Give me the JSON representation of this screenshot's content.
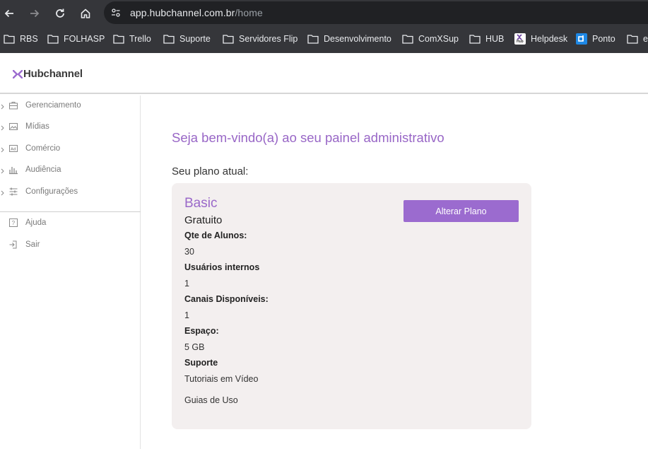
{
  "browser": {
    "url_host": "app.hubchannel.com.br",
    "url_path": "/home",
    "bookmarks": [
      "RBS",
      "FOLHASP",
      "Trello",
      "Suporte",
      "Servidores Flip",
      "Desenvolvimento",
      "ComXSup",
      "HUB",
      "Helpdesk",
      "Ponto",
      "e"
    ],
    "helpdesk_favicon_text": "Hub"
  },
  "app": {
    "logo_text": "Hubchannel",
    "brand_color": "#9b6bcf"
  },
  "sidebar": {
    "items": [
      {
        "label": "Gerenciamento",
        "icon": "briefcase-icon"
      },
      {
        "label": "Mídias",
        "icon": "image-icon"
      },
      {
        "label": "Comércio",
        "icon": "ad-icon"
      },
      {
        "label": "Audiência",
        "icon": "bar-chart-icon"
      },
      {
        "label": "Configurações",
        "icon": "sliders-icon"
      }
    ],
    "bottom_items": [
      {
        "label": "Ajuda",
        "icon": "help-icon"
      },
      {
        "label": "Sair",
        "icon": "logout-icon"
      }
    ]
  },
  "main": {
    "welcome": "Seja bem-vindo(a) ao seu painel administrativo",
    "plan_label": "Seu plano atual:",
    "plan": {
      "name": "Basic",
      "price": "Gratuito",
      "button": "Alterar Plano",
      "fields": [
        {
          "label": "Qte de Alunos:",
          "value": "30"
        },
        {
          "label": "Usuários internos",
          "value": "1"
        },
        {
          "label": "Canais Disponíveis:",
          "value": "1"
        },
        {
          "label": "Espaço:",
          "value": "5 GB"
        },
        {
          "label": "Suporte",
          "value": "Tutoriais em Vídeo"
        }
      ],
      "extra_support": "Guias de Uso"
    }
  }
}
